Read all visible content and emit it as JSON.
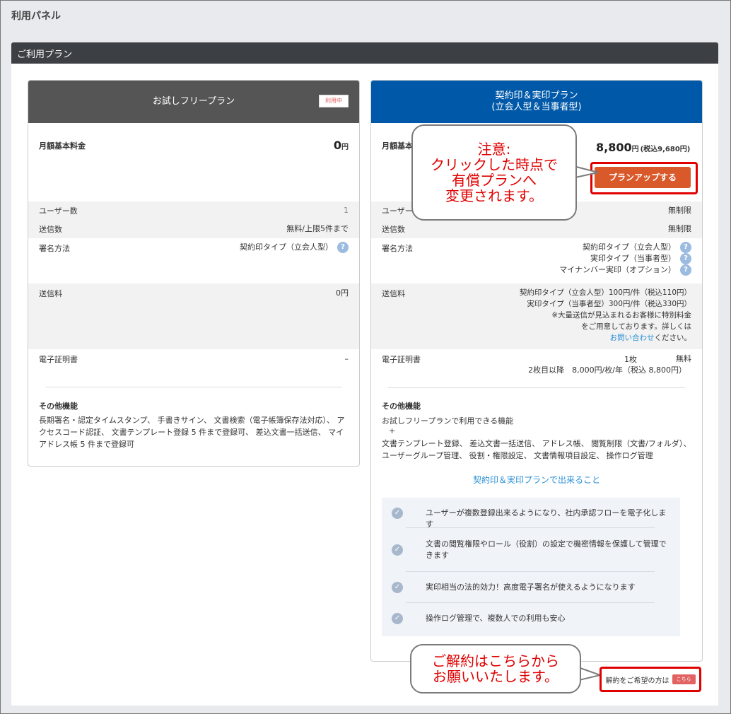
{
  "page": {
    "title": "利用パネル"
  },
  "panel": {
    "header": "ご利用プラン"
  },
  "free_plan": {
    "name": "お試しフリープラン",
    "badge": "利用中",
    "monthly_label": "月額基本料金",
    "monthly_price": "0",
    "monthly_unit": "円",
    "users_label": "ユーザー数",
    "users_value": "1",
    "sends_label": "送信数",
    "sends_value": "無料/上限5件まで",
    "sign_label": "署名方法",
    "sign_value": "契約印タイプ（立会人型）",
    "fee_label": "送信料",
    "fee_value": "0円",
    "cert_label": "電子証明書",
    "cert_value": "–",
    "other_label": "その他機能",
    "other_text": "長期署名・認定タイムスタンプ、 手書きサイン、 文書検索（電子帳簿保存法対応）、 アクセスコード認証、 文書テンプレート登録 5 件まで登録可、 差込文書一括送信、 マイアドレス帳 5 件まで登録可"
  },
  "paid_plan": {
    "name_line1": "契約印＆実印プラン",
    "name_line2": "(立会人型＆当事者型)",
    "monthly_label": "月額基本",
    "monthly_price": "8,800",
    "monthly_unit": "円",
    "monthly_tax": "(税込9,680円)",
    "upgrade_button": "プランアップする",
    "users_label": "ユーザー",
    "users_value": "無制限",
    "sends_label": "送信数",
    "sends_value": "無制限",
    "sign_label": "署名方法",
    "sign_values": [
      "契約印タイプ（立会人型）",
      "実印タイプ（当事者型）",
      "マイナンバー実印（オプション）"
    ],
    "fee_label": "送信料",
    "fee_lines": [
      "契約印タイプ（立会人型）100円/件（税込110円）",
      "実印タイプ（当事者型）300円/件（税込330円）",
      "※大量送信が見込まれるお客様に特別料金",
      "をご用意しております。詳しくは"
    ],
    "fee_link": "お問い合わせ",
    "fee_link_suffix": "ください。",
    "cert_label": "電子証明書",
    "cert_count": "1枚",
    "cert_free": "無料",
    "cert_extra": "2枚目以降　8,000円/枚/年（税込 8,800円）",
    "other_label": "その他機能",
    "other_line1": "お試しフリープランで利用できる機能",
    "other_plus": "+",
    "other_text": "文書テンプレート登録、 差込文書一括送信、 アドレス帳、 閲覧制限（文書/フォルダ）、 ユーザーグループ管理、 役割・権限設定、 文書情報項目設定、 操作ログ管理",
    "can_do_link": "契約印＆実印プランで出来ること",
    "benefits": [
      "ユーザーが複数登録出来るようになり、社内承認フローを電子化します",
      "文書の閲覧権限やロール（役割）の設定で機密情報を保護して管理できます",
      "実印相当の法的効力！高度電子署名が使えるようになります",
      "操作ログ管理で、複数人での利用も安心"
    ]
  },
  "callout_notice": {
    "lines": [
      "注意:",
      "クリックした時点で",
      "有償プランへ",
      "変更されます。"
    ]
  },
  "callout_cancel": {
    "lines": [
      "ご解約はこちらから",
      "お願いいたします。"
    ]
  },
  "cancel": {
    "label": "解約をご希望の方は",
    "badge": "こちら"
  },
  "colors": {
    "header_dark": "#3c3f44",
    "free_head": "#555555",
    "paid_head": "#0059a8",
    "upgrade": "#d9592b",
    "annotation_red": "#e00000",
    "link": "#2a8fd6"
  }
}
